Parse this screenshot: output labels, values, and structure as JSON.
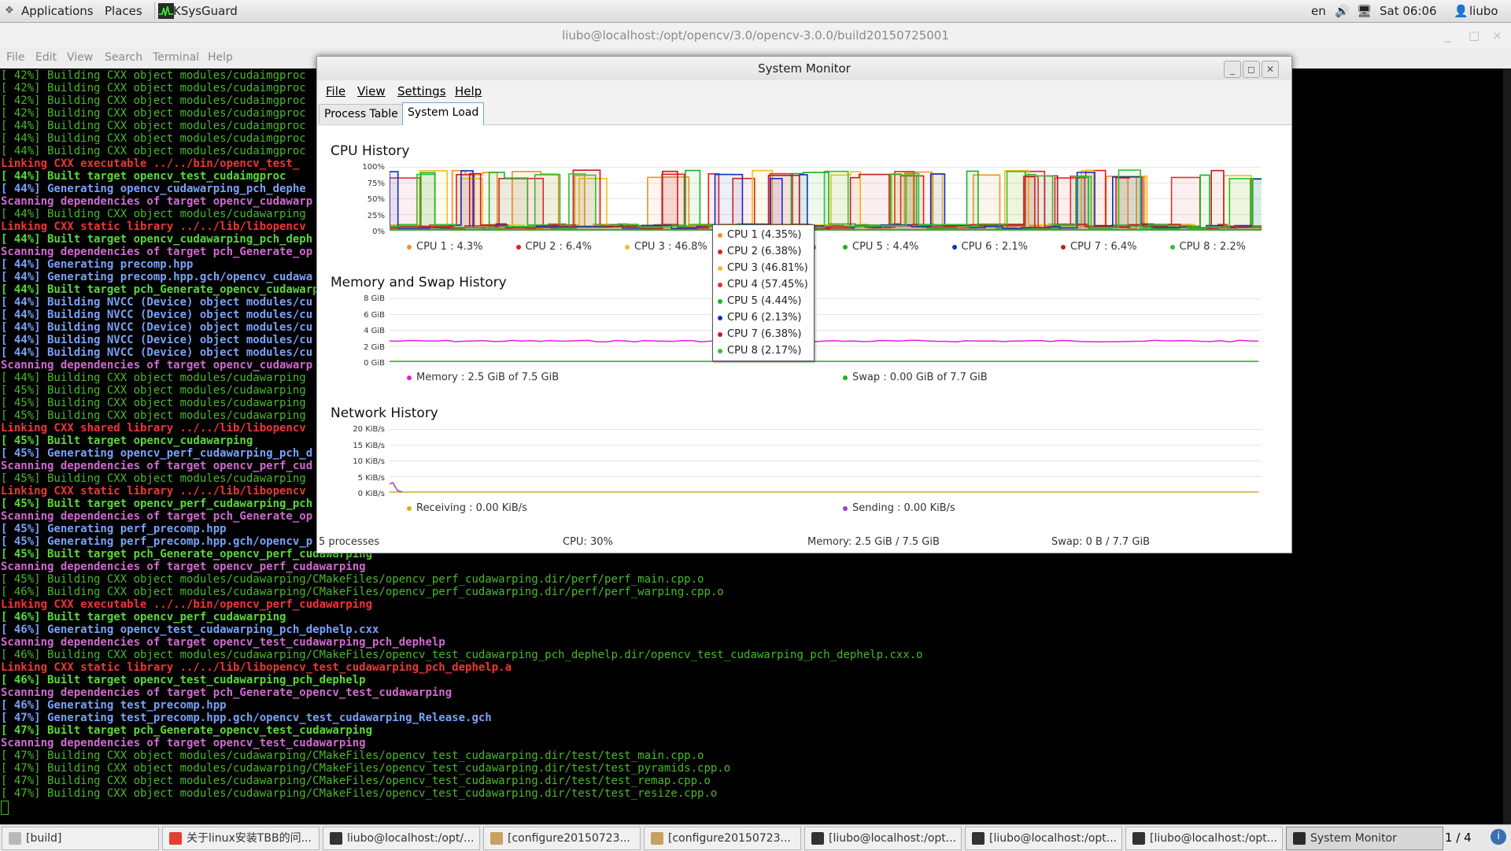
{
  "topbar": {
    "applications": "Applications",
    "places": "Places",
    "app": "KSysGuard",
    "lang": "en",
    "clock": "Sat 06:06",
    "user": "liubo"
  },
  "terminal": {
    "title": "liubo@localhost:/opt/opencv/3.0/opencv-3.0.0/build20150725001",
    "menu": [
      "File",
      "Edit",
      "View",
      "Search",
      "Terminal",
      "Help"
    ],
    "lines": [
      {
        "t": "[ 42%] Building CXX object modules/cudaimgproc",
        "c": "green"
      },
      {
        "t": "[ 42%] Building CXX object modules/cudaimgproc",
        "c": "green"
      },
      {
        "t": "[ 42%] Building CXX object modules/cudaimgproc",
        "c": "green"
      },
      {
        "t": "[ 42%] Building CXX object modules/cudaimgproc",
        "c": "green"
      },
      {
        "t": "[ 44%] Building CXX object modules/cudaimgproc",
        "c": "green"
      },
      {
        "t": "[ 44%] Building CXX object modules/cudaimgproc",
        "c": "green"
      },
      {
        "t": "[ 44%] Building CXX object modules/cudaimgproc",
        "c": "green"
      },
      {
        "t": "Linking CXX executable ../../bin/opencv_test_",
        "c": "red"
      },
      {
        "t": "[ 44%] Built target opencv_test_cudaimgproc",
        "c": "bgreen"
      },
      {
        "t": "[ 44%] Generating opencv_cudawarping_pch_dephe",
        "c": "blue"
      },
      {
        "t": "Scanning dependencies of target opencv_cudawarp",
        "c": "magenta"
      },
      {
        "t": "[ 44%] Building CXX object modules/cudawarping",
        "c": "green"
      },
      {
        "t": "Linking CXX static library ../../lib/libopencv",
        "c": "red"
      },
      {
        "t": "[ 44%] Built target opencv_cudawarping_pch_deph",
        "c": "bgreen"
      },
      {
        "t": "Scanning dependencies of target pch_Generate_op",
        "c": "magenta"
      },
      {
        "t": "[ 44%] Generating precomp.hpp",
        "c": "blue"
      },
      {
        "t": "[ 44%] Generating precomp.hpp.gch/opencv_cudawa",
        "c": "blue"
      },
      {
        "t": "[ 44%] Built target pch_Generate_opencv_cudawarp",
        "c": "bgreen"
      },
      {
        "t": "[ 44%] Building NVCC (Device) object modules/cu",
        "c": "blue"
      },
      {
        "t": "[ 44%] Building NVCC (Device) object modules/cu",
        "c": "blue"
      },
      {
        "t": "[ 44%] Building NVCC (Device) object modules/cu",
        "c": "blue"
      },
      {
        "t": "[ 44%] Building NVCC (Device) object modules/cu",
        "c": "blue"
      },
      {
        "t": "[ 44%] Building NVCC (Device) object modules/cu",
        "c": "blue"
      },
      {
        "t": "Scanning dependencies of target opencv_cudawarp",
        "c": "magenta"
      },
      {
        "t": "[ 44%] Building CXX object modules/cudawarping",
        "c": "green"
      },
      {
        "t": "[ 45%] Building CXX object modules/cudawarping",
        "c": "green"
      },
      {
        "t": "[ 45%] Building CXX object modules/cudawarping",
        "c": "green"
      },
      {
        "t": "[ 45%] Building CXX object modules/cudawarping",
        "c": "green"
      },
      {
        "t": "Linking CXX shared library ../../lib/libopencv",
        "c": "red"
      },
      {
        "t": "[ 45%] Built target opencv_cudawarping",
        "c": "bgreen"
      },
      {
        "t": "[ 45%] Generating opencv_perf_cudawarping_pch_d",
        "c": "blue"
      },
      {
        "t": "Scanning dependencies of target opencv_perf_cud",
        "c": "magenta"
      },
      {
        "t": "[ 45%] Building CXX object modules/cudawarping",
        "c": "green"
      },
      {
        "t": "Linking CXX static library ../../lib/libopencv",
        "c": "red"
      },
      {
        "t": "[ 45%] Built target opencv_perf_cudawarping_pch",
        "c": "bgreen"
      },
      {
        "t": "Scanning dependencies of target pch_Generate_op",
        "c": "magenta"
      },
      {
        "t": "[ 45%] Generating perf_precomp.hpp",
        "c": "blue"
      },
      {
        "t": "[ 45%] Generating perf_precomp.hpp.gch/opencv_p",
        "c": "blue"
      },
      {
        "t": "[ 45%] Built target pch_Generate_opencv_perf_cudawarping",
        "c": "bgreen"
      },
      {
        "t": "Scanning dependencies of target opencv_perf_cudawarping",
        "c": "magenta"
      },
      {
        "t": "[ 45%] Building CXX object modules/cudawarping/CMakeFiles/opencv_perf_cudawarping.dir/perf/perf_main.cpp.o",
        "c": "green"
      },
      {
        "t": "[ 46%] Building CXX object modules/cudawarping/CMakeFiles/opencv_perf_cudawarping.dir/perf/perf_warping.cpp.o",
        "c": "green"
      },
      {
        "t": "Linking CXX executable ../../bin/opencv_perf_cudawarping",
        "c": "red"
      },
      {
        "t": "[ 46%] Built target opencv_perf_cudawarping",
        "c": "bgreen"
      },
      {
        "t": "[ 46%] Generating opencv_test_cudawarping_pch_dephelp.cxx",
        "c": "blue"
      },
      {
        "t": "Scanning dependencies of target opencv_test_cudawarping_pch_dephelp",
        "c": "magenta"
      },
      {
        "t": "[ 46%] Building CXX object modules/cudawarping/CMakeFiles/opencv_test_cudawarping_pch_dephelp.dir/opencv_test_cudawarping_pch_dephelp.cxx.o",
        "c": "green"
      },
      {
        "t": "Linking CXX static library ../../lib/libopencv_test_cudawarping_pch_dephelp.a",
        "c": "red"
      },
      {
        "t": "[ 46%] Built target opencv_test_cudawarping_pch_dephelp",
        "c": "bgreen"
      },
      {
        "t": "Scanning dependencies of target pch_Generate_opencv_test_cudawarping",
        "c": "magenta"
      },
      {
        "t": "[ 46%] Generating test_precomp.hpp",
        "c": "blue"
      },
      {
        "t": "[ 47%] Generating test_precomp.hpp.gch/opencv_test_cudawarping_Release.gch",
        "c": "blue"
      },
      {
        "t": "[ 47%] Built target pch_Generate_opencv_test_cudawarping",
        "c": "bgreen"
      },
      {
        "t": "Scanning dependencies of target opencv_test_cudawarping",
        "c": "magenta"
      },
      {
        "t": "[ 47%] Building CXX object modules/cudawarping/CMakeFiles/opencv_test_cudawarping.dir/test/test_main.cpp.o",
        "c": "green"
      },
      {
        "t": "[ 47%] Building CXX object modules/cudawarping/CMakeFiles/opencv_test_cudawarping.dir/test/test_pyramids.cpp.o",
        "c": "green"
      },
      {
        "t": "[ 47%] Building CXX object modules/cudawarping/CMakeFiles/opencv_test_cudawarping.dir/test/test_remap.cpp.o",
        "c": "green"
      },
      {
        "t": "[ 47%] Building CXX object modules/cudawarping/CMakeFiles/opencv_test_cudawarping.dir/test/test_resize.cpp.o",
        "c": "green"
      }
    ]
  },
  "sysmon": {
    "title": "System Monitor",
    "menu": [
      "File",
      "View",
      "Settings",
      "Help"
    ],
    "tabs": [
      "Process Table",
      "System Load"
    ],
    "cpu_title": "CPU History",
    "cpu_ticks": [
      "100%",
      "75%",
      "50%",
      "25%",
      "0%"
    ],
    "cpu_legend": [
      {
        "label": "CPU 1 : 4.3%",
        "color": "#f0902a"
      },
      {
        "label": "CPU 2 : 6.4%",
        "color": "#e02020"
      },
      {
        "label": "CPU 3 : 46.8%",
        "color": "#f0c020"
      },
      {
        "label": "CPU 4 : 57.4%",
        "color": "#e03030"
      },
      {
        "label": "CPU 5 : 4.4%",
        "color": "#20b020"
      },
      {
        "label": "CPU 6 : 2.1%",
        "color": "#1030c0"
      },
      {
        "label": "CPU 7 : 6.4%",
        "color": "#c02020"
      },
      {
        "label": "CPU 8 : 2.2%",
        "color": "#30c030"
      }
    ],
    "mem_title": "Memory and Swap History",
    "mem_ticks": [
      "8 GiB",
      "6 GiB",
      "4 GiB",
      "2 GiB",
      "0 GiB"
    ],
    "mem_legend": [
      {
        "label": "Memory : 2.5 GiB of 7.5 GiB",
        "color": "#e020e0"
      },
      {
        "label": "Swap : 0.00 GiB of 7.7 GiB",
        "color": "#20b020"
      }
    ],
    "net_title": "Network History",
    "net_ticks": [
      "20 KiB/s",
      "15 KiB/s",
      "10 KiB/s",
      "5 KiB/s",
      "0 KiB/s"
    ],
    "net_legend": [
      {
        "label": "Receiving : 0.00 KiB/s",
        "color": "#d0b020"
      },
      {
        "label": "Sending : 0.00 KiB/s",
        "color": "#a040c0"
      }
    ],
    "tooltip": [
      {
        "label": "CPU 1 (4.35%)",
        "color": "#f0902a"
      },
      {
        "label": "CPU 2 (6.38%)",
        "color": "#e02020"
      },
      {
        "label": "CPU 3 (46.81%)",
        "color": "#f0c020"
      },
      {
        "label": "CPU 4 (57.45%)",
        "color": "#e03030"
      },
      {
        "label": "CPU 5 (4.44%)",
        "color": "#20b020"
      },
      {
        "label": "CPU 6 (2.13%)",
        "color": "#1030c0"
      },
      {
        "label": "CPU 7 (6.38%)",
        "color": "#c02020"
      },
      {
        "label": "CPU 8 (2.17%)",
        "color": "#30c030"
      }
    ],
    "status": {
      "processes": "5 processes",
      "cpu": "CPU: 30%",
      "memory": "Memory: 2.5 GiB / 7.5 GiB",
      "swap": "Swap: 0 B / 7.7 GiB"
    },
    "memory_level": 0.33,
    "swap_level": 0.0
  },
  "taskbar": {
    "tasks": [
      {
        "label": "[build]",
        "icon": "folder-icon"
      },
      {
        "label": "关于linux安装TBB的问...",
        "icon": "chrome-icon"
      },
      {
        "label": "liubo@localhost:/opt/...",
        "icon": "terminal-icon"
      },
      {
        "label": "[configure20150723...",
        "icon": "editor-icon"
      },
      {
        "label": "[configure20150723...",
        "icon": "editor-icon"
      },
      {
        "label": "[liubo@localhost:/opt...",
        "icon": "terminal-icon"
      },
      {
        "label": "[liubo@localhost:/opt...",
        "icon": "terminal-icon"
      },
      {
        "label": "[liubo@localhost:/opt...",
        "icon": "terminal-icon"
      },
      {
        "label": "System Monitor",
        "icon": "sysmon-icon"
      }
    ],
    "workspace": "1 / 4"
  }
}
